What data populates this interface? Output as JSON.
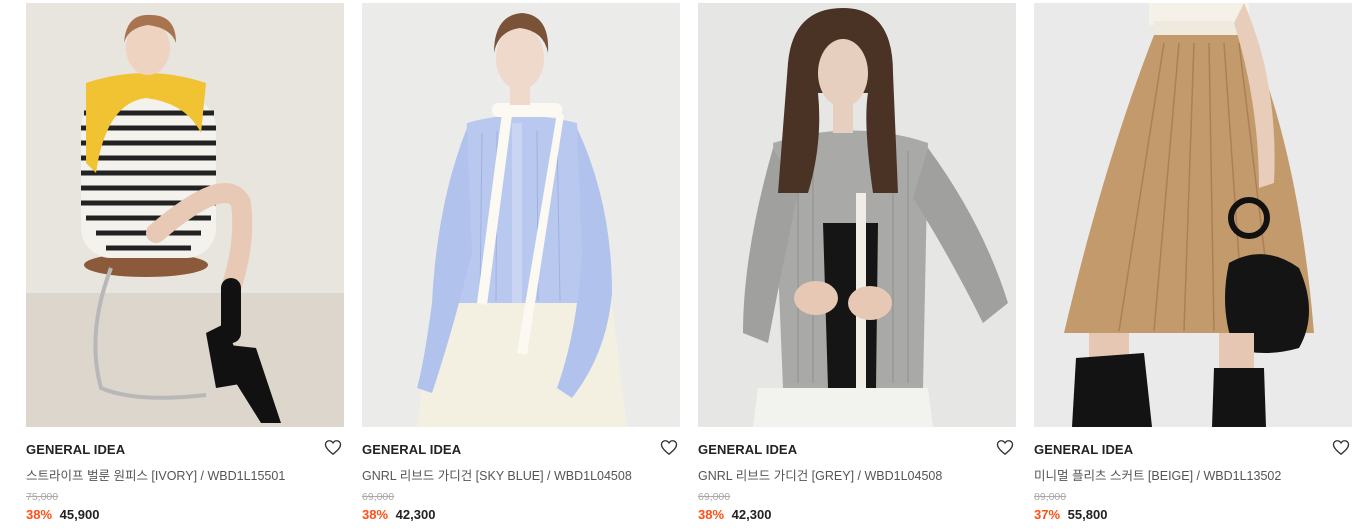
{
  "products": [
    {
      "brand": "GENERAL IDEA",
      "name": "스트라이프 벌룬 원피스 [IVORY] / WBD1L15501",
      "original_price": "75,000",
      "discount": "38%",
      "price": "45,900",
      "image": "model-in-striped-dress-with-yellow-scarf-on-chair"
    },
    {
      "brand": "GENERAL IDEA",
      "name": "GNRL 리브드 가디건 [SKY BLUE] / WBD1L04508",
      "original_price": "69,000",
      "discount": "38%",
      "price": "42,300",
      "image": "model-in-sky-blue-ribbed-cardigan"
    },
    {
      "brand": "GENERAL IDEA",
      "name": "GNRL 리브드 가디건 [GREY] / WBD1L04508",
      "original_price": "69,000",
      "discount": "38%",
      "price": "42,300",
      "image": "model-in-grey-ribbed-cardigan"
    },
    {
      "brand": "GENERAL IDEA",
      "name": "미니멀 플리츠 스커트 [BEIGE] / WBD1L13502",
      "original_price": "89,000",
      "discount": "37%",
      "price": "55,800",
      "image": "model-in-beige-pleated-skirt-with-black-bag"
    }
  ],
  "colors": {
    "discount": "#ff4f17",
    "brand_text": "#222222",
    "name_text": "#555555",
    "strike_text": "#aaaaaa"
  },
  "icons": {
    "wishlist": "heart-outline-icon"
  }
}
